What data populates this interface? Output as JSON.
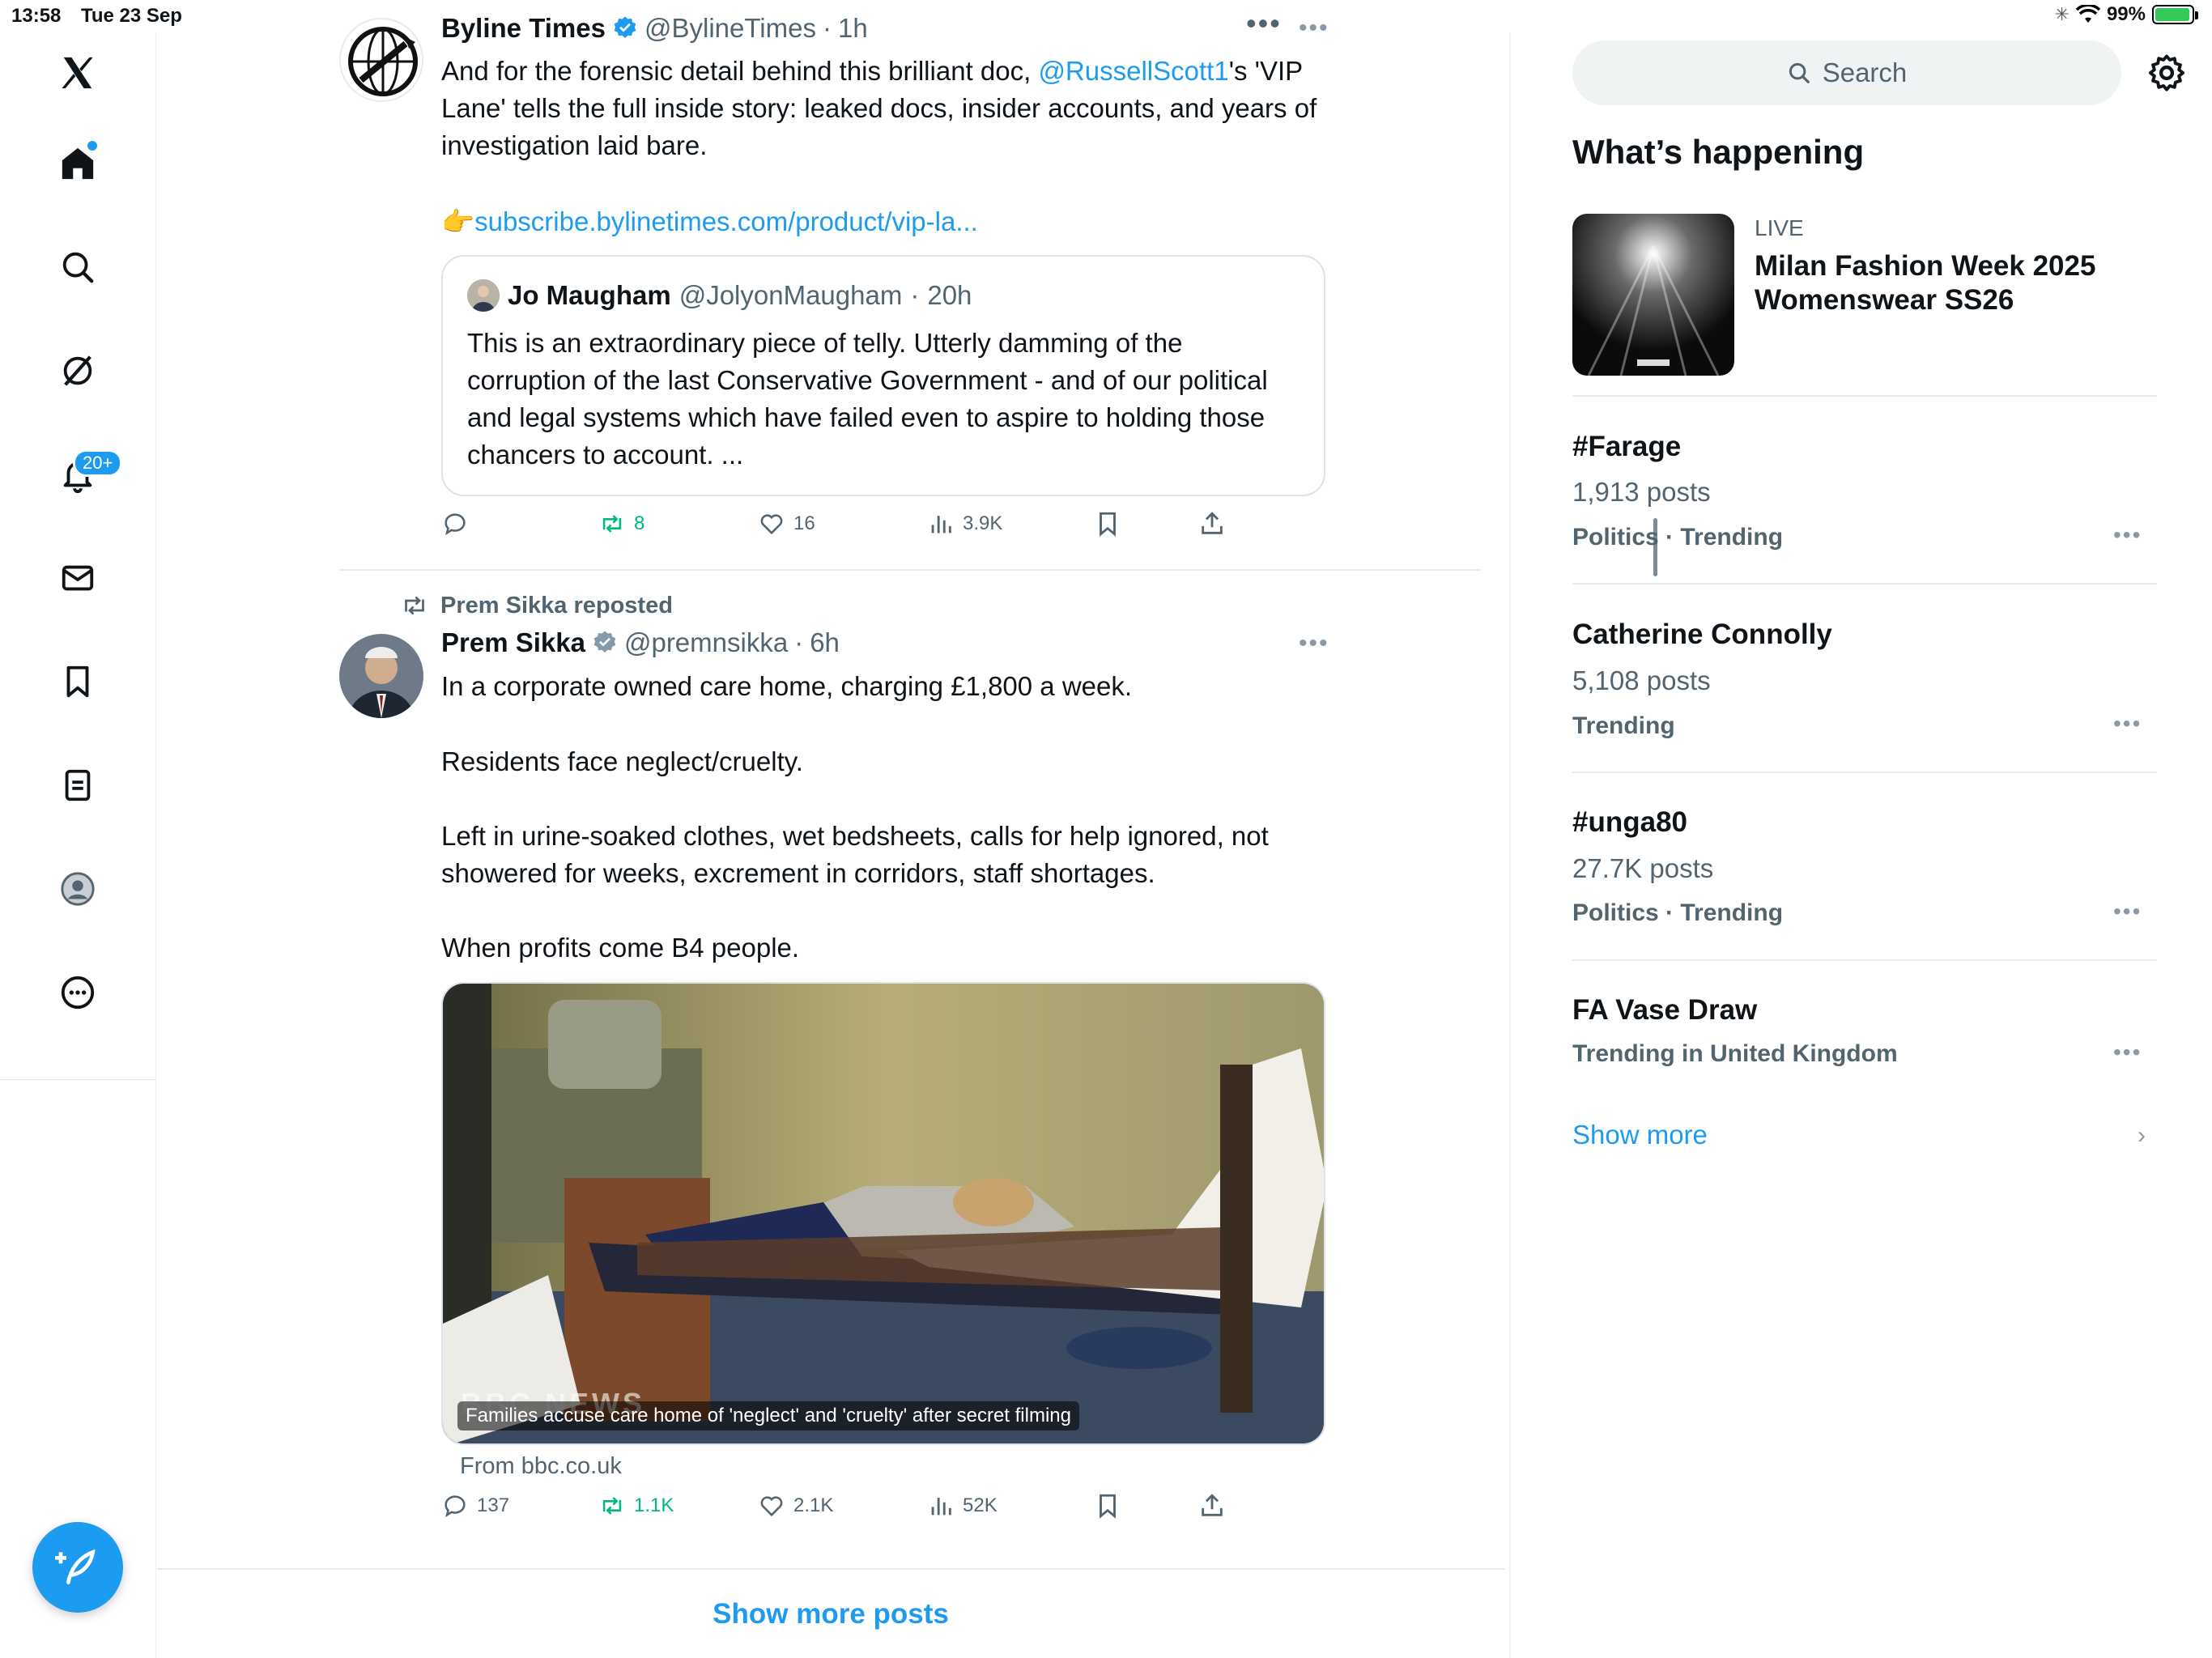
{
  "status": {
    "time": "13:58",
    "date": "Tue 23 Sep",
    "battery": "99%"
  },
  "nav": {
    "notifications_badge": "20+"
  },
  "top_more": "•••",
  "post1": {
    "name": "Byline Times",
    "handle": "@BylineTimes",
    "time": "1h",
    "text_pre": "And for the forensic detail behind this brilliant doc, ",
    "mention": "@RussellScott1",
    "text_post": "'s 'VIP Lane' tells the full inside story: leaked docs, insider accounts, and years of investigation laid bare.",
    "link_emoji": "👉",
    "link": "subscribe.bylinetimes.com/product/vip-la...",
    "quote": {
      "name": "Jo Maugham",
      "handle": "@JolyonMaugham",
      "time": "20h",
      "text": "This is an extraordinary piece of telly. Utterly damming of the corruption of the last Conservative Government - and of our political and legal systems which have failed even to aspire to holding those chancers to account. ..."
    },
    "reposts": "8",
    "likes": "16",
    "views": "3.9K"
  },
  "post2": {
    "repost_by": "Prem Sikka reposted",
    "name": "Prem Sikka",
    "handle": "@premnsikka",
    "time": "6h",
    "p1": "In a corporate owned care home,  charging £1,800 a week.",
    "p2": "Residents face neglect/cruelty.",
    "p3": "Left in urine-soaked clothes, wet bedsheets, calls for help ignored, not showered for weeks, excrement in corridors, staff shortages.",
    "p4": "When profits come B4 people.",
    "media_watermark": "BBC NEWS",
    "media_caption": "Families accuse care home of 'neglect' and 'cruelty' after secret filming",
    "from": "From bbc.co.uk",
    "replies": "137",
    "reposts": "1.1K",
    "likes": "2.1K",
    "views": "52K"
  },
  "show_more_posts": "Show more posts",
  "sidebar": {
    "search_placeholder": "Search",
    "title": "What’s happening",
    "live": {
      "label": "LIVE",
      "title": "Milan Fashion Week 2025 Womenswear SS26"
    },
    "trends": [
      {
        "name": "#Farage",
        "count": "1,913 posts",
        "category": "Politics · Trending"
      },
      {
        "name": "Catherine Connolly",
        "count": "5,108 posts",
        "category": "Trending"
      },
      {
        "name": "#unga80",
        "count": "27.7K posts",
        "category": "Politics · Trending"
      },
      {
        "name": "FA Vase Draw",
        "count": "",
        "category": "Trending in United Kingdom"
      }
    ],
    "show_more": "Show more"
  },
  "colors": {
    "accent": "#1d9bf0",
    "repost_green": "#00ba7c",
    "muted": "#536471"
  },
  "icons": [
    "x-logo-icon",
    "home-icon",
    "search-icon",
    "grok-icon",
    "bell-icon",
    "mail-icon",
    "bookmark-icon",
    "lists-icon",
    "profile-icon",
    "more-circle-icon",
    "compose-icon",
    "verified-icon",
    "reply-icon",
    "repost-icon",
    "like-icon",
    "views-icon",
    "share-icon",
    "gear-icon",
    "chevron-right-icon"
  ]
}
